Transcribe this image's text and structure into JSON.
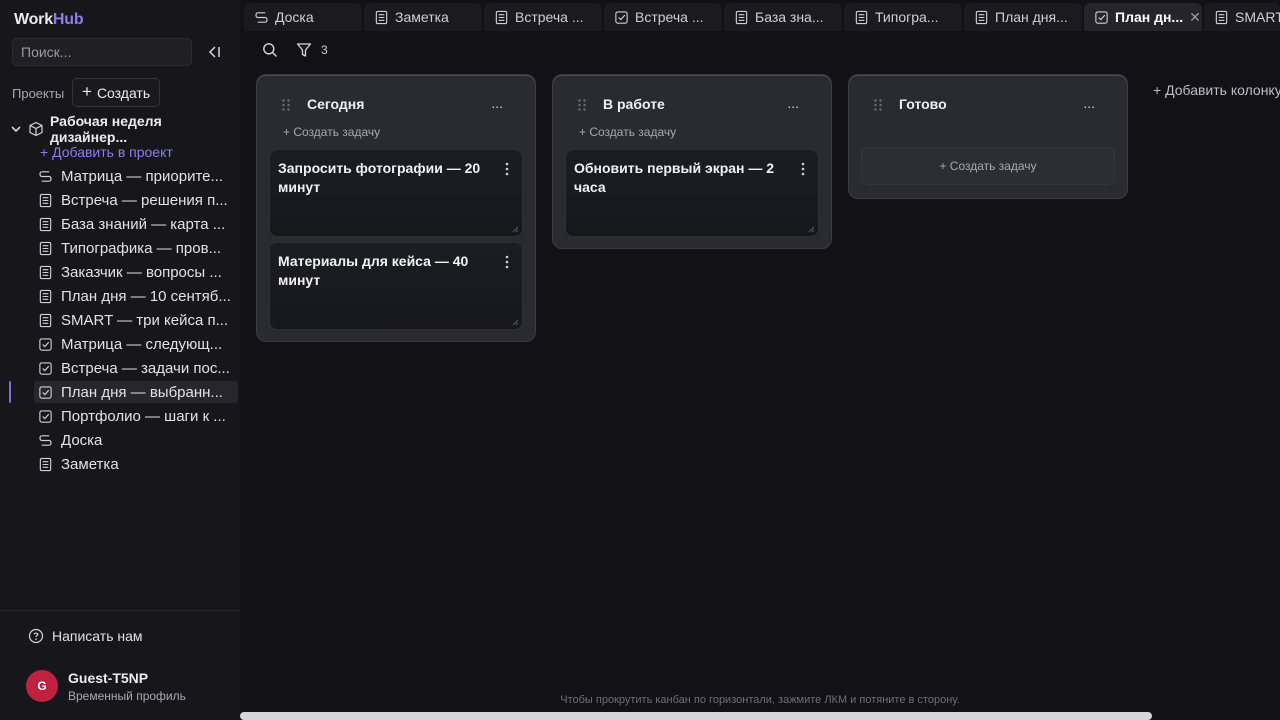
{
  "app": {
    "logo_part1": "Work",
    "logo_part2": "Hub"
  },
  "sidebar": {
    "search_placeholder": "Поиск...",
    "projects_label": "Проекты",
    "create_label": "Создать",
    "project_name": "Рабочая неделя дизайнер...",
    "add_to_project": "+ Добавить в проект",
    "items": [
      {
        "icon": "board-icon",
        "label": "Матрица — приорите..."
      },
      {
        "icon": "note-icon",
        "label": "Встреча — решения п..."
      },
      {
        "icon": "note-icon",
        "label": "База знаний — карта ..."
      },
      {
        "icon": "note-icon",
        "label": "Типографика — пров..."
      },
      {
        "icon": "note-icon",
        "label": "Заказчик — вопросы ..."
      },
      {
        "icon": "note-icon",
        "label": "План дня — 10 сентяб..."
      },
      {
        "icon": "note-icon",
        "label": "SMART — три кейса п..."
      },
      {
        "icon": "task-icon",
        "label": "Матрица — следующ..."
      },
      {
        "icon": "task-icon",
        "label": "Встреча — задачи пос..."
      },
      {
        "icon": "task-icon",
        "label": "План дня — выбранн..."
      },
      {
        "icon": "task-icon",
        "label": "Портфолио — шаги к ..."
      },
      {
        "icon": "board-icon",
        "label": "Доска"
      },
      {
        "icon": "note-icon",
        "label": "Заметка"
      }
    ],
    "active_index": 9,
    "contact_label": "Написать нам",
    "user": {
      "initial": "G",
      "name": "Guest-T5NP",
      "subtitle": "Временный профиль"
    }
  },
  "tabs": [
    {
      "icon": "board-icon",
      "label": "Доска"
    },
    {
      "icon": "note-icon",
      "label": "Заметка"
    },
    {
      "icon": "note-icon",
      "label": "Встреча ..."
    },
    {
      "icon": "task-icon",
      "label": "Встреча ..."
    },
    {
      "icon": "note-icon",
      "label": "База зна..."
    },
    {
      "icon": "note-icon",
      "label": "Типогра..."
    },
    {
      "icon": "note-icon",
      "label": "План дня..."
    },
    {
      "icon": "task-icon",
      "label": "План дн...",
      "active": true
    },
    {
      "icon": "note-icon",
      "label": "SMART"
    }
  ],
  "toolbar": {
    "filter_count": "3"
  },
  "board": {
    "columns": [
      {
        "title": "Сегодня",
        "menu": "...",
        "add_task": "+ Создать задачу",
        "cards": [
          {
            "title": "Запросить фотографии — 20 минут"
          },
          {
            "title": "Материалы для кейса — 40 минут"
          }
        ]
      },
      {
        "title": "В работе",
        "menu": "...",
        "add_task": "+ Создать задачу",
        "cards": [
          {
            "title": "Обновить первый экран — 2 часа"
          }
        ]
      },
      {
        "title": "Готово",
        "menu": "...",
        "add_task": "+ Создать задачу",
        "cards": []
      }
    ],
    "add_column": "+ Добавить колонку"
  },
  "hint": "Чтобы прокрутить канбан по горизонтали, зажмите ЛКМ и потяните в сторону.",
  "colors": {
    "accent": "#8b7ee8",
    "avatar": "#c0213f",
    "background": "#121216"
  }
}
